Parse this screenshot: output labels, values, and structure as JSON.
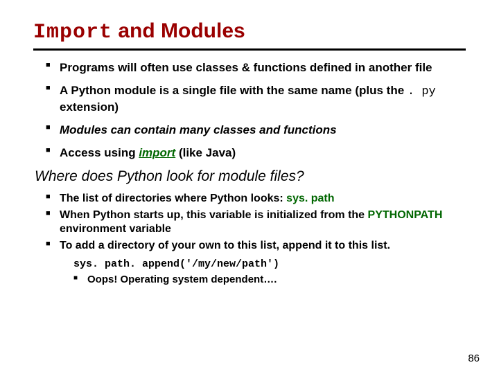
{
  "title": {
    "mono": "Import",
    "rest": " and Modules"
  },
  "bullets1": [
    {
      "pre": "Programs will often use classes & functions defined in another file"
    },
    {
      "pre": "A Python module is a single file with the same name (plus the ",
      "mono": ". py",
      "post": " extension)"
    },
    {
      "italic": "Modules can contain many classes and functions"
    },
    {
      "pre": "Access using ",
      "kw": "import",
      "post": " (like Java)"
    }
  ],
  "subhead": "Where does Python look for module files?",
  "bullets2": [
    {
      "pre": "The list of directories where Python looks:  ",
      "kw": "sys. path"
    },
    {
      "pre": "When Python starts up, this variable is initialized from the ",
      "kw": "PYTHONPATH",
      "post": " environment variable"
    },
    {
      "pre": "To add a directory of your own to this list, append it to this list."
    }
  ],
  "code": "sys. path. append('/my/new/path')",
  "oops": "Oops!  Operating system dependent….",
  "page": "86"
}
